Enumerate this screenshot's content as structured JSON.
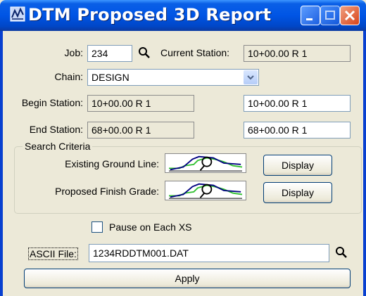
{
  "window": {
    "title": "DTM Proposed 3D Report"
  },
  "job": {
    "label": "Job:",
    "value": "234"
  },
  "current_station": {
    "label": "Current Station:",
    "value": "10+00.00 R 1"
  },
  "chain": {
    "label": "Chain:",
    "value": "DESIGN"
  },
  "begin_station": {
    "label": "Begin Station:",
    "readonly_value": "10+00.00 R 1",
    "value": "10+00.00 R 1"
  },
  "end_station": {
    "label": "End Station:",
    "readonly_value": "68+00.00 R 1",
    "value": "68+00.00 R 1"
  },
  "search_criteria": {
    "title": "Search Criteria",
    "existing_ground_line": {
      "label": "Existing Ground Line:",
      "button": "Display"
    },
    "proposed_finish_grade": {
      "label": "Proposed Finish Grade:",
      "button": "Display"
    }
  },
  "pause": {
    "label": "Pause on Each XS",
    "checked": false
  },
  "ascii_file": {
    "label": "ASCII File:",
    "value": "1234RDDTM001.DAT"
  },
  "apply_button": "Apply",
  "colors": {
    "titlebar": "#0055e5",
    "dialog": "#ece9d8",
    "close_button": "#d8441a"
  },
  "icons": [
    "dtm-app-icon",
    "search-icon",
    "chevron-down-icon",
    "minimize-icon",
    "maximize-icon",
    "close-icon",
    "profile-graph-icon"
  ]
}
